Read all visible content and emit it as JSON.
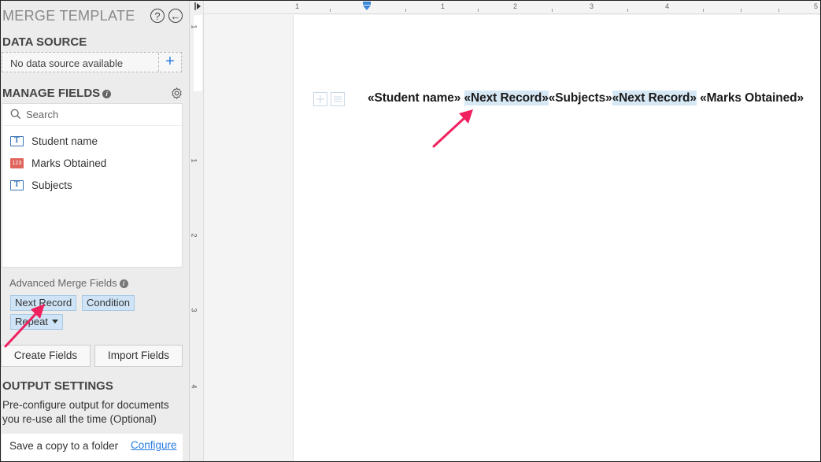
{
  "panel": {
    "title": "MERGE TEMPLATE",
    "help_glyph": "?",
    "back_glyph": "←",
    "data_source": {
      "heading": "DATA SOURCE",
      "empty_text": "No data source available",
      "add_glyph": "+"
    },
    "manage_fields": {
      "heading": "MANAGE FIELDS",
      "info_glyph": "i",
      "search_placeholder": "Search",
      "fields": [
        {
          "label": "Student name",
          "type": "text",
          "icon": "text-field-icon"
        },
        {
          "label": "Marks Obtained",
          "type": "number",
          "icon": "number-field-icon",
          "icon_text": "123"
        },
        {
          "label": "Subjects",
          "type": "text",
          "icon": "text-field-icon"
        }
      ]
    },
    "advanced": {
      "heading": "Advanced Merge Fields",
      "chips": [
        "Next Record",
        "Condition",
        "Repeat"
      ]
    },
    "buttons": {
      "create": "Create Fields",
      "import": "Import Fields"
    },
    "output": {
      "heading": "OUTPUT SETTINGS",
      "description": "Pre-configure output for documents you re-use all the time (Optional)",
      "save_label": "Save a copy to a folder",
      "configure_link": "Configure"
    }
  },
  "document": {
    "ruler_marks": [
      "1",
      "1",
      "2",
      "3",
      "4",
      "5"
    ],
    "vertical_ruler_marks": [
      "1",
      "1",
      "2",
      "3",
      "4"
    ],
    "merge_line": [
      {
        "text": "«Student name» ",
        "highlight": false
      },
      {
        "text": "«Next Record»",
        "highlight": true
      },
      {
        "text": "«Subjects»",
        "highlight": false
      },
      {
        "text": "«Next Record»",
        "highlight": true
      },
      {
        "text": " «Marks Obtained»",
        "highlight": false
      }
    ]
  },
  "colors": {
    "accent": "#2a7de1",
    "chip_bg": "#cfe5f7",
    "annotation_arrow": "#f0215f",
    "number_icon": "#e0655c"
  }
}
